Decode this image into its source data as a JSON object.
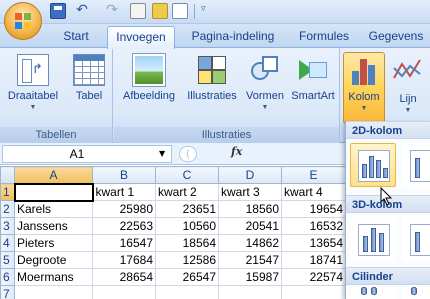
{
  "quick_access": {
    "undo_glyph": "↶",
    "redo_glyph": "↷",
    "more_glyph": "▿"
  },
  "tabs": [
    "Start",
    "Invoegen",
    "Pagina-indeling",
    "Formules",
    "Gegevens"
  ],
  "active_tab": "Invoegen",
  "ribbon": {
    "tabellen": {
      "label": "Tabellen",
      "buttons": [
        "Draaitabel",
        "Tabel"
      ]
    },
    "illustraties": {
      "label": "Illustraties",
      "buttons": [
        "Afbeelding",
        "Illustraties",
        "Vormen",
        "SmartArt"
      ]
    },
    "grafieken": {
      "buttons": [
        "Kolom",
        "Lijn"
      ]
    }
  },
  "formula_bar": {
    "name_box": "A1",
    "fx": "fx"
  },
  "grid": {
    "columns": [
      "A",
      "B",
      "C",
      "D",
      "E"
    ],
    "row_numbers": [
      "1",
      "2",
      "3",
      "4",
      "5",
      "6",
      "7"
    ],
    "header_row": [
      "",
      "kwart 1",
      "kwart 2",
      "kwart 3",
      "kwart 4"
    ],
    "rows": [
      {
        "name": "Karels",
        "values": [
          "25980",
          "23651",
          "18560",
          "19654"
        ]
      },
      {
        "name": "Janssens",
        "values": [
          "22563",
          "10560",
          "20541",
          "16532"
        ]
      },
      {
        "name": "Pieters",
        "values": [
          "16547",
          "18564",
          "14862",
          "13654"
        ]
      },
      {
        "name": "Degroote",
        "values": [
          "17684",
          "12586",
          "21547",
          "18741"
        ]
      },
      {
        "name": "Moermans",
        "values": [
          "28654",
          "26547",
          "15987",
          "22574"
        ]
      }
    ]
  },
  "chart_gallery": {
    "sections": [
      "2D-kolom",
      "3D-kolom",
      "Cilinder"
    ]
  },
  "colors": {
    "ribbon_text": "#15428b",
    "selected_button": "#ffd45a",
    "column_bar": "#4f81bd",
    "column_bar_alt": "#c0504d"
  }
}
